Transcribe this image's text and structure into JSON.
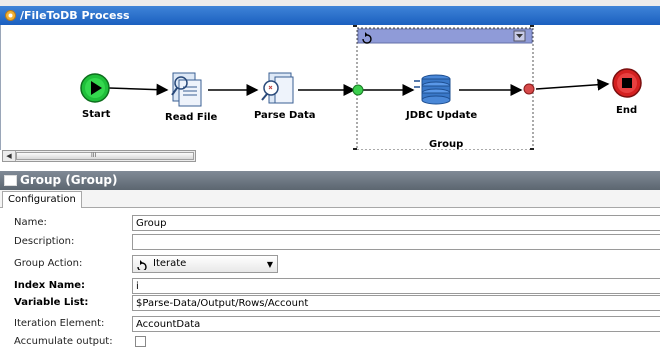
{
  "process": {
    "title": "/FileToDB Process"
  },
  "nodes": {
    "start": "Start",
    "read_file": "Read File",
    "parse_data": "Parse Data",
    "jdbc_update": "JDBC Update",
    "end": "End"
  },
  "group_box": {
    "label": "Group"
  },
  "scrollbar": {
    "grip": "III"
  },
  "panel": {
    "title": "Group (Group)",
    "tab": "Configuration"
  },
  "form": {
    "name": {
      "label": "Name:",
      "value": "Group"
    },
    "description": {
      "label": "Description:",
      "value": ""
    },
    "group_action": {
      "label": "Group Action:",
      "value": "Iterate"
    },
    "index_name": {
      "label": "Index Name:",
      "value": "i"
    },
    "variable_list": {
      "label": "Variable List:",
      "value": "$Parse-Data/Output/Rows/Account"
    },
    "iteration_element": {
      "label": "Iteration Element:",
      "value": "AccountData"
    },
    "accumulate_output": {
      "label": "Accumulate output:",
      "checked": false
    }
  },
  "colors": {
    "title_bar": "#1b5fbf",
    "panel_title": "#6a7480",
    "start_green": "#1fbf3a",
    "end_red": "#d42020",
    "group_header": "#8f9bd8"
  },
  "icons": [
    "process-icon",
    "start-icon",
    "read-file-icon",
    "parse-data-icon",
    "jdbc-icon",
    "end-icon",
    "iterate-icon",
    "dropdown-icon"
  ]
}
